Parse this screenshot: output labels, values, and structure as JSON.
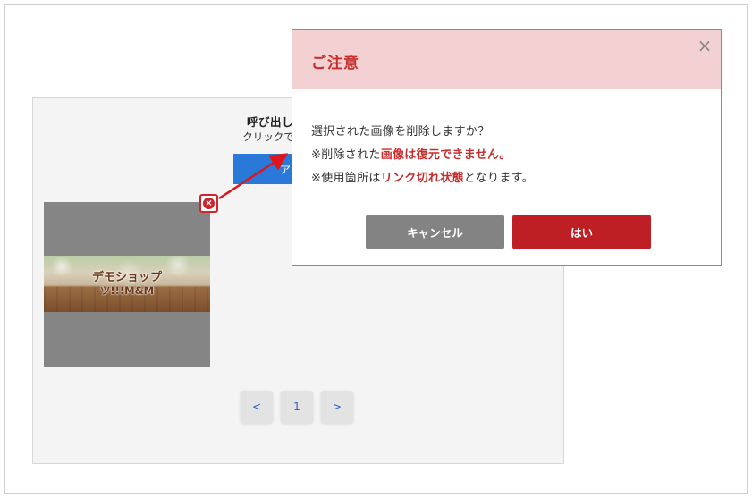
{
  "panel": {
    "title": "呼び出したいイメー",
    "subtitle": "クリックできないイメー",
    "upload_label": "アップ",
    "thumbnail": {
      "line1": "デモショップ",
      "line2": "ツ!!!M&M"
    },
    "delete_icon": "close-circle-icon",
    "pagination": {
      "prev": "<",
      "page": "1",
      "next": ">"
    }
  },
  "modal": {
    "title": "ご注意",
    "close_icon": "×",
    "message_line1": "選択された画像を削除しますか？",
    "message_line2_prefix": "※削除された",
    "message_line2_highlight": "画像は復元できません。",
    "message_line3_prefix": "※使用箇所は",
    "message_line3_highlight": "リンク切れ状態",
    "message_line3_suffix": "となります。",
    "cancel_label": "キャンセル",
    "confirm_label": "はい"
  },
  "colors": {
    "accent_red": "#be1f24",
    "header_pink": "#f3d1d2",
    "upload_blue": "#2a79d8",
    "cancel_gray": "#838383",
    "annotation_red": "#e0141b"
  }
}
